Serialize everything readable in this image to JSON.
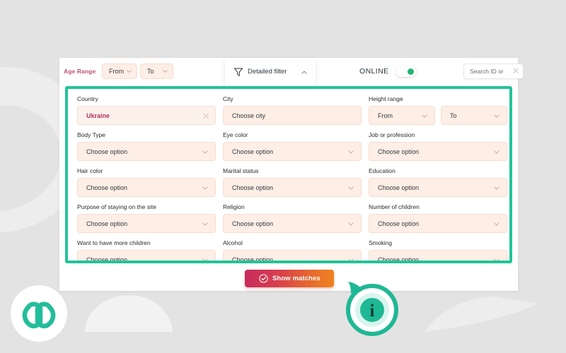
{
  "toolbar": {
    "age_range_label": "Age Range",
    "age_from": "From",
    "age_to": "To",
    "detailed_filter_label": "Detailed filter",
    "online_label": "ONLINE",
    "search_placeholder": "Search ID or"
  },
  "filters": {
    "rows": [
      [
        {
          "label": "Country",
          "value": "Ukraine",
          "type": "cleared",
          "filled": true
        },
        {
          "label": "City",
          "value": "Choose city",
          "type": "text",
          "filled": false
        },
        {
          "label": "Height range",
          "value_from": "From",
          "value_to": "To",
          "type": "range"
        }
      ],
      [
        {
          "label": "Body Type",
          "value": "Choose option",
          "type": "select"
        },
        {
          "label": "Eye color",
          "value": "Choose option",
          "type": "select"
        },
        {
          "label": "Job or profession",
          "value": "Choose option",
          "type": "select"
        }
      ],
      [
        {
          "label": "Hair color",
          "value": "Choose option",
          "type": "select"
        },
        {
          "label": "Marital status",
          "value": "Choose option",
          "type": "select"
        },
        {
          "label": "Education",
          "value": "Choose option",
          "type": "select"
        }
      ],
      [
        {
          "label": "Purpose of staying on the site",
          "value": "Choose option",
          "type": "select"
        },
        {
          "label": "Religion",
          "value": "Choose option",
          "type": "select"
        },
        {
          "label": "Number of children",
          "value": "Choose option",
          "type": "select"
        }
      ],
      [
        {
          "label": "Want to have more children",
          "value": "Choose option",
          "type": "select"
        },
        {
          "label": "Alcohol",
          "value": "Choose option",
          "type": "select"
        },
        {
          "label": "Smoking",
          "value": "Choose option",
          "type": "select"
        }
      ]
    ]
  },
  "actions": {
    "show_matches_label": "Show matches"
  },
  "info_bubble": {
    "glyph": "i"
  },
  "colors": {
    "page_background": "#e3e3e3",
    "card_background": "#ffffff",
    "highlight_border": "#22c39a",
    "field_background": "#fdeee6",
    "field_border": "#f6ddd0",
    "accent_pink": "#c0517a",
    "value_text": "#b0335c",
    "online_dot": "#22b573",
    "brand_teal": "#24bd9b",
    "button_gradient_start": "#c62a5e",
    "button_gradient_end": "#ef8420"
  }
}
